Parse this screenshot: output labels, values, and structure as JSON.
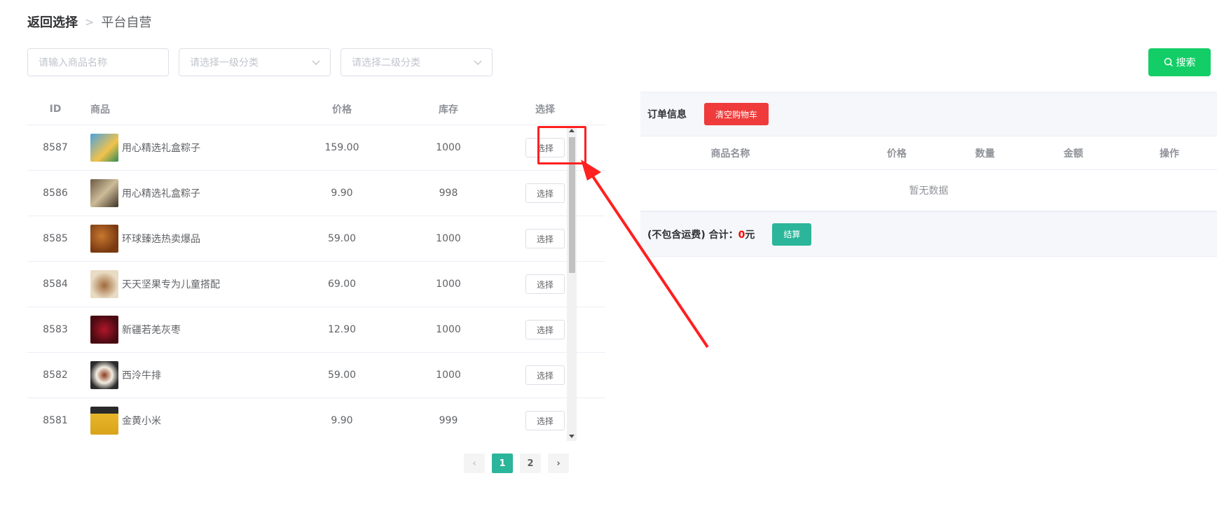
{
  "breadcrumb": {
    "back": "返回选择",
    "separator": ">",
    "current": "平台自营"
  },
  "filters": {
    "name_placeholder": "请输入商品名称",
    "cat1_placeholder": "请选择一级分类",
    "cat2_placeholder": "请选择二级分类",
    "search_label": "搜索"
  },
  "goods_table": {
    "headers": {
      "id": "ID",
      "goods": "商品",
      "price": "价格",
      "stock": "库存",
      "select": "选择"
    },
    "rows": [
      {
        "id": "8587",
        "name": "用心精选礼盒粽子",
        "price": "159.00",
        "stock": "1000",
        "action": "选择"
      },
      {
        "id": "8586",
        "name": "用心精选礼盒粽子",
        "price": "9.90",
        "stock": "998",
        "action": "选择"
      },
      {
        "id": "8585",
        "name": "环球臻选热卖爆品",
        "price": "59.00",
        "stock": "1000",
        "action": "选择"
      },
      {
        "id": "8584",
        "name": "天天坚果专为儿童搭配",
        "price": "69.00",
        "stock": "1000",
        "action": "选择"
      },
      {
        "id": "8583",
        "name": "新疆若羌灰枣",
        "price": "12.90",
        "stock": "1000",
        "action": "选择"
      },
      {
        "id": "8582",
        "name": "西泠牛排",
        "price": "59.00",
        "stock": "1000",
        "action": "选择"
      },
      {
        "id": "8581",
        "name": "金黄小米",
        "price": "9.90",
        "stock": "999",
        "action": "选择"
      }
    ]
  },
  "pagination": {
    "prev": "‹",
    "pages": [
      "1",
      "2"
    ],
    "active": "1",
    "next": "›"
  },
  "order_panel": {
    "title": "订单信息",
    "clear_label": "清空购物车",
    "columns": {
      "name": "商品名称",
      "price": "价格",
      "qty": "数量",
      "amount": "金额",
      "op": "操作"
    },
    "empty_text": "暂无数据",
    "total_prefix": "(不包含运费) 合计：",
    "total_value": "0",
    "total_unit": "元",
    "checkout_label": "结算"
  },
  "colors": {
    "primary_green": "#13ce66",
    "teal": "#2bb59a",
    "danger": "#ef3b3b",
    "annotation_red": "#ff2020"
  }
}
